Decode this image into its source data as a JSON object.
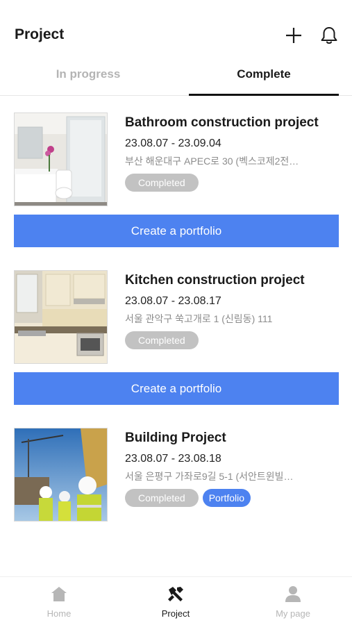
{
  "header": {
    "title": "Project",
    "add_icon": "plus-icon",
    "notification_icon": "bell-icon"
  },
  "tabs": [
    {
      "label": "In progress",
      "active": false
    },
    {
      "label": "Complete",
      "active": true
    }
  ],
  "projects": [
    {
      "name": "Bathroom construction project",
      "dates": "23.08.07 - 23.09.04",
      "address": "부산 해운대구 APEC로 30 (벡스코제2전…",
      "status": "Completed",
      "image": "bathroom-photo",
      "action": "Create a portfolio"
    },
    {
      "name": "Kitchen construction project",
      "dates": "23.08.07 - 23.08.17",
      "address": "서울 관악구 쑥고개로 1 (신림동) 111",
      "status": "Completed",
      "image": "kitchen-photo",
      "action": "Create a portfolio"
    },
    {
      "name": "Building Project",
      "dates": "23.08.07 - 23.08.18",
      "address": "서울 은평구 가좌로9길 5-1 (서안트윈빌…",
      "status": "Completed",
      "portfolio": "Portfolio",
      "image": "construction-workers-photo"
    }
  ],
  "bottom_nav": [
    {
      "label": "Home",
      "icon": "home-icon",
      "active": false
    },
    {
      "label": "Project",
      "icon": "project-icon",
      "active": true
    },
    {
      "label": "My page",
      "icon": "person-icon",
      "active": false
    }
  ],
  "colors": {
    "accent": "#4d82f0",
    "badge_gray": "#c2c2c2",
    "inactive_text": "#b4b4b4"
  }
}
